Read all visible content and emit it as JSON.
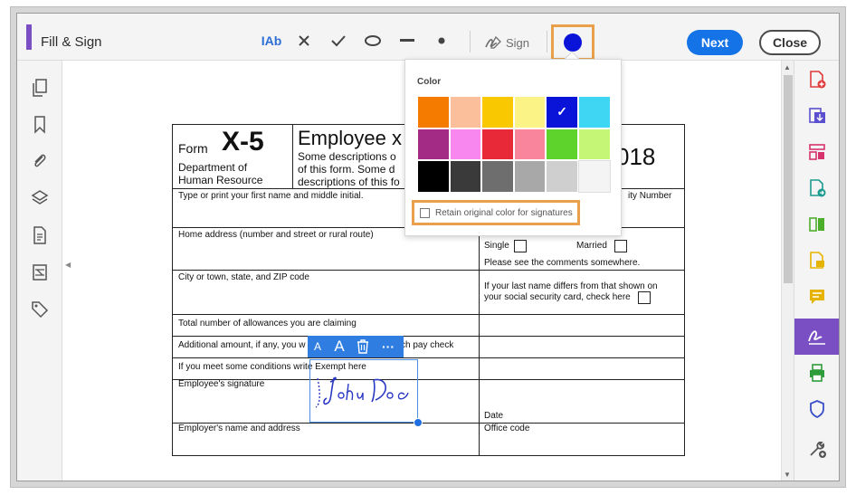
{
  "toolbar": {
    "title": "Fill & Sign",
    "text_tool_label": "IAb",
    "sign_label": "Sign",
    "next_label": "Next",
    "close_label": "Close",
    "selected_color": "#0a14d9",
    "icons": [
      "text-tool-icon",
      "cross-icon",
      "check-icon",
      "ellipse-icon",
      "line-icon",
      "dot-icon",
      "sign-icon",
      "color-picker-icon"
    ]
  },
  "left_rail": {
    "icons": [
      "pages-icon",
      "bookmark-icon",
      "attachment-icon",
      "layers-icon",
      "document-icon",
      "compare-icon",
      "tag-icon"
    ]
  },
  "right_rail": {
    "icons": [
      "create-pdf-icon",
      "export-pdf-icon",
      "organize-pages-icon",
      "edit-pdf-icon",
      "combine-icon",
      "comment-file-icon",
      "comment-icon",
      "fill-sign-icon",
      "print-production-icon",
      "protect-icon",
      "more-tools-icon"
    ],
    "active": "fill-sign-icon"
  },
  "color_popover": {
    "label": "Color",
    "swatches": [
      "#f57b00",
      "#fbbf9c",
      "#f9c800",
      "#fbf385",
      "#0a14d9",
      "#3fd6f4",
      "#a32b86",
      "#f987f0",
      "#e82937",
      "#f9859c",
      "#5ed32b",
      "#c5f676",
      "#000000",
      "#3a3a3a",
      "#6e6e6e",
      "#a8a8a8",
      "#cfcfcf",
      "#f4f4f4"
    ],
    "selected_index": 4,
    "retain_label": "Retain original color for signatures"
  },
  "form": {
    "form_word": "Form",
    "form_code": "X-5",
    "dept_line1": "Department of",
    "dept_line2": "Human Resource",
    "heading": "Employee x",
    "desc1": "Some descriptions o",
    "desc2": "of this form. Some d",
    "desc3": "descriptions of this fo",
    "year_fragment": "018",
    "row1_label": "Type or print your first name and middle initial.",
    "ssn_fragment": "ity Number",
    "home_label": "Home address (number and street or rural route)",
    "single_label": "Single",
    "married_label": "Married",
    "see_comments": "Please see the comments somewhere.",
    "city_label": "City or town, state, and ZIP code",
    "lastname1": "If your last name differs from that shown on",
    "lastname2": "your social security card, check here",
    "allowances": "Total number of allowances you are claiming",
    "additional_a": "Additional amount, if any, you w",
    "additional_b": "ch pay check",
    "exempt": "If you meet some conditions write Exempt here",
    "emp_sig": "Employee's signature",
    "date_label": "Date",
    "employer": "Employer's name and address",
    "office": "Office code",
    "signature": "John Doe"
  },
  "sig_toolbar": {
    "small_a": "A",
    "large_a": "A",
    "more": "···"
  }
}
